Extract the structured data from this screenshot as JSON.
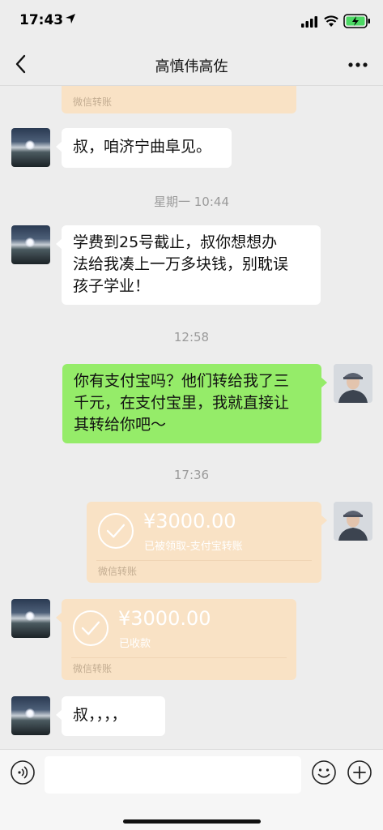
{
  "status_bar": {
    "time": "17:43",
    "icons": [
      "location-arrow-icon",
      "signal-icon",
      "wifi-icon",
      "battery-charging-icon"
    ]
  },
  "nav": {
    "title": "高慎伟高佐",
    "back_icon": "chevron-left-icon",
    "more_icon": "more-dots-icon"
  },
  "messages": [
    {
      "type": "transfer-partial",
      "side": "left",
      "footer": "微信转账"
    },
    {
      "type": "text",
      "side": "left",
      "text": "叔，咱济宁曲阜见。"
    },
    {
      "type": "timestamp",
      "text": "星期一 10:44"
    },
    {
      "type": "text",
      "side": "left",
      "lines": [
        "学费到25号截止，叔你想想办",
        "法给我凑上一万多块钱，别耽误",
        "孩子学业！"
      ]
    },
    {
      "type": "timestamp",
      "text": "12:58"
    },
    {
      "type": "text",
      "side": "right",
      "lines": [
        "你有支付宝吗？他们转给我了三",
        "千元，在支付宝里，我就直接让",
        "其转给你吧～"
      ]
    },
    {
      "type": "timestamp",
      "text": "17:36"
    },
    {
      "type": "transfer",
      "side": "right",
      "amount": "¥3000.00",
      "status": "已被领取-支付宝转账",
      "footer": "微信转账"
    },
    {
      "type": "transfer",
      "side": "left",
      "amount": "¥3000.00",
      "status": "已收款",
      "footer": "微信转账"
    },
    {
      "type": "text",
      "side": "left",
      "text": "叔，，，，"
    }
  ],
  "input_bar": {
    "placeholder": "",
    "icons": [
      "voice-icon",
      "emoji-icon",
      "plus-icon"
    ]
  },
  "colors": {
    "background": "#ededed",
    "bubble_green": "#95ec69",
    "bubble_white": "#ffffff",
    "transfer": "#f9e2c5"
  }
}
